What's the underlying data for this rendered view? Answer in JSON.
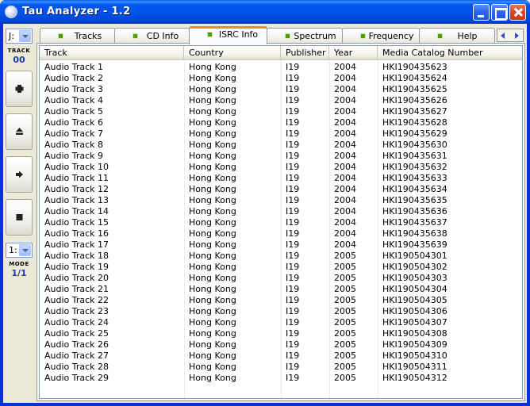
{
  "window": {
    "title": "Tau Analyzer - 1.2"
  },
  "left_panel": {
    "drive_value": "J:",
    "track_label": "TRACK",
    "track_number": "00",
    "mode_select_value": "1:",
    "mode_label": "MODE",
    "mode_value": "1/1"
  },
  "tabs": [
    {
      "label": "Tracks",
      "active": false
    },
    {
      "label": "CD Info",
      "active": false
    },
    {
      "label": "ISRC Info",
      "active": true
    },
    {
      "label": "Spectrum",
      "active": false
    },
    {
      "label": "Frequency",
      "active": false
    },
    {
      "label": "Help",
      "active": false
    }
  ],
  "table": {
    "columns": [
      "Track",
      "Country",
      "Publisher",
      "Year",
      "Media Catalog Number"
    ],
    "rows": [
      [
        "Audio Track 1",
        "Hong Kong",
        "I19",
        "2004",
        "HKI190435623"
      ],
      [
        "Audio Track 2",
        "Hong Kong",
        "I19",
        "2004",
        "HKI190435624"
      ],
      [
        "Audio Track 3",
        "Hong Kong",
        "I19",
        "2004",
        "HKI190435625"
      ],
      [
        "Audio Track 4",
        "Hong Kong",
        "I19",
        "2004",
        "HKI190435626"
      ],
      [
        "Audio Track 5",
        "Hong Kong",
        "I19",
        "2004",
        "HKI190435627"
      ],
      [
        "Audio Track 6",
        "Hong Kong",
        "I19",
        "2004",
        "HKI190435628"
      ],
      [
        "Audio Track 7",
        "Hong Kong",
        "I19",
        "2004",
        "HKI190435629"
      ],
      [
        "Audio Track 8",
        "Hong Kong",
        "I19",
        "2004",
        "HKI190435630"
      ],
      [
        "Audio Track 9",
        "Hong Kong",
        "I19",
        "2004",
        "HKI190435631"
      ],
      [
        "Audio Track 10",
        "Hong Kong",
        "I19",
        "2004",
        "HKI190435632"
      ],
      [
        "Audio Track 11",
        "Hong Kong",
        "I19",
        "2004",
        "HKI190435633"
      ],
      [
        "Audio Track 12",
        "Hong Kong",
        "I19",
        "2004",
        "HKI190435634"
      ],
      [
        "Audio Track 13",
        "Hong Kong",
        "I19",
        "2004",
        "HKI190435635"
      ],
      [
        "Audio Track 14",
        "Hong Kong",
        "I19",
        "2004",
        "HKI190435636"
      ],
      [
        "Audio Track 15",
        "Hong Kong",
        "I19",
        "2004",
        "HKI190435637"
      ],
      [
        "Audio Track 16",
        "Hong Kong",
        "I19",
        "2004",
        "HKI190435638"
      ],
      [
        "Audio Track 17",
        "Hong Kong",
        "I19",
        "2004",
        "HKI190435639"
      ],
      [
        "Audio Track 18",
        "Hong Kong",
        "I19",
        "2005",
        "HKI190504301"
      ],
      [
        "Audio Track 19",
        "Hong Kong",
        "I19",
        "2005",
        "HKI190504302"
      ],
      [
        "Audio Track 20",
        "Hong Kong",
        "I19",
        "2005",
        "HKI190504303"
      ],
      [
        "Audio Track 21",
        "Hong Kong",
        "I19",
        "2005",
        "HKI190504304"
      ],
      [
        "Audio Track 22",
        "Hong Kong",
        "I19",
        "2005",
        "HKI190504305"
      ],
      [
        "Audio Track 23",
        "Hong Kong",
        "I19",
        "2005",
        "HKI190504306"
      ],
      [
        "Audio Track 24",
        "Hong Kong",
        "I19",
        "2005",
        "HKI190504307"
      ],
      [
        "Audio Track 25",
        "Hong Kong",
        "I19",
        "2005",
        "HKI190504308"
      ],
      [
        "Audio Track 26",
        "Hong Kong",
        "I19",
        "2005",
        "HKI190504309"
      ],
      [
        "Audio Track 27",
        "Hong Kong",
        "I19",
        "2005",
        "HKI190504310"
      ],
      [
        "Audio Track 28",
        "Hong Kong",
        "I19",
        "2005",
        "HKI190504311"
      ],
      [
        "Audio Track 29",
        "Hong Kong",
        "I19",
        "2005",
        "HKI190504312"
      ]
    ]
  },
  "icons": [
    "app-icon",
    "minimize-icon",
    "maximize-icon",
    "close-icon",
    "plus-icon",
    "eject-icon",
    "play-icon",
    "stop-icon",
    "chevron-down-icon",
    "arrow-left-icon",
    "arrow-right-icon"
  ],
  "colors": {
    "titlebar": "#0054e3",
    "active_tab_accent": "#e68b2c",
    "tab_led": "#4f9a0b",
    "counter_text": "#1a3aa8"
  }
}
